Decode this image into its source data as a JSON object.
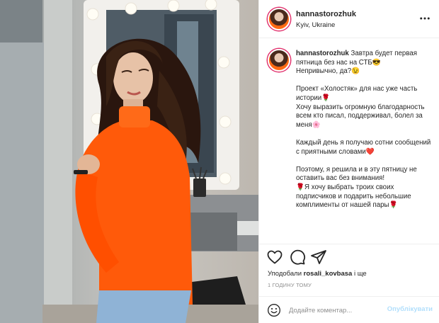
{
  "post": {
    "username": "hannastorozhuk",
    "location": "Kyiv, Ukraine"
  },
  "caption": {
    "username": "hannastorozhuk",
    "text": " Завтра будет первая пятница без нас на СТБ😎\nНепривычно, да?😉\n\nПроект «Холостяк» для нас уже часть истории🌹\nХочу выразить огромную благодарность всем кто писал, поддерживал, болел за меня🌸\n\nКаждый день я получаю сотни сообщений с приятными словами❤️\n\nПоэтому, я решила и в эту пятницу не оставить вас без внимания!\n🌹Я хочу выбрать троих своих подписчиков и подарить небольшие комплименты от нашей пары🌹"
  },
  "likes": {
    "prefix": "Уподобали ",
    "user": "rosali_kovbasa",
    "suffix": " і ще"
  },
  "time_ago": "1 ГОДИНУ ТОМУ",
  "comment": {
    "placeholder": "Додайте коментар...",
    "publish_label": "Опублікувати"
  },
  "icons": {
    "more": "more-horizontal-icon",
    "like": "heart-icon",
    "comment": "comment-icon",
    "share": "share-icon",
    "emoji": "emoji-icon"
  },
  "colors": {
    "sweater": "#ff5a0a",
    "publish_disabled": "#b2dffc",
    "muted": "#8e8e8e"
  }
}
